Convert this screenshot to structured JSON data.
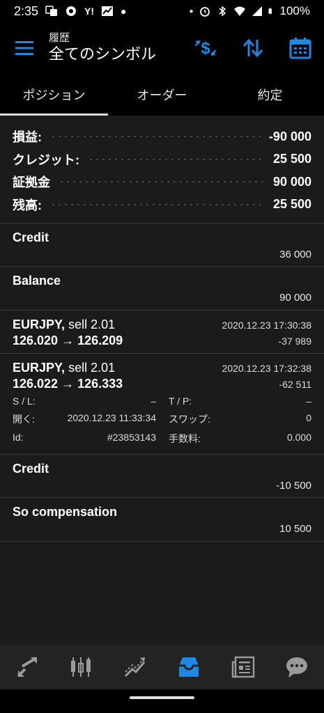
{
  "status_bar": {
    "time": "2:35",
    "battery": "100%"
  },
  "app_bar": {
    "subtitle": "履歴",
    "title": "全てのシンボル"
  },
  "tabs": [
    {
      "label": "ポジション"
    },
    {
      "label": "オーダー"
    },
    {
      "label": "約定"
    }
  ],
  "summary": [
    {
      "label": "損益:",
      "value": "-90 000"
    },
    {
      "label": "クレジット:",
      "value": "25 500"
    },
    {
      "label": "証拠金",
      "value": "90 000"
    },
    {
      "label": "残高:",
      "value": "25 500"
    }
  ],
  "entries": {
    "credit1": {
      "name": "Credit",
      "amount": "36 000"
    },
    "balance": {
      "name": "Balance",
      "amount": "90 000"
    },
    "deal1": {
      "symbol": "EURJPY,",
      "side": "sell 2.01",
      "prices": "126.020 → 126.209",
      "time": "2020.12.23 17:30:38",
      "profit": "-37 989"
    },
    "deal2": {
      "symbol": "EURJPY,",
      "side": "sell 2.01",
      "prices": "126.022 → 126.333",
      "time": "2020.12.23 17:32:38",
      "profit": "-62 511",
      "sl_label": "S / L:",
      "sl_value": "–",
      "tp_label": "T / P:",
      "tp_value": "–",
      "open_label": "開く:",
      "open_value": "2020.12.23 11:33:34",
      "swap_label": "スワップ:",
      "swap_value": "0",
      "id_label": "Id:",
      "id_value": "#23853143",
      "fee_label": "手数料:",
      "fee_value": "0.000"
    },
    "credit2": {
      "name": "Credit",
      "amount": "-10 500"
    },
    "compensation": {
      "name": "So compensation",
      "amount": "10 500"
    }
  },
  "colors": {
    "accent": "#1e88e5",
    "background": "#1b1b1b",
    "top_bar": "#000000"
  },
  "bottom_nav": [
    {
      "icon": "quotes-icon"
    },
    {
      "icon": "chart-icon"
    },
    {
      "icon": "trade-icon"
    },
    {
      "icon": "history-icon"
    },
    {
      "icon": "news-icon"
    },
    {
      "icon": "chat-icon"
    }
  ]
}
